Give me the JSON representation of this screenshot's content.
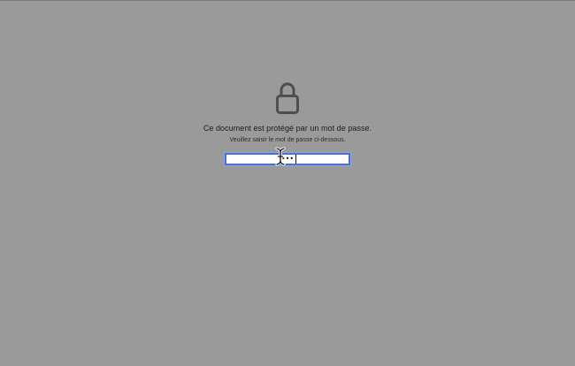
{
  "lock": {
    "icon": "lock-icon"
  },
  "prompt": {
    "title": "Ce document est protégé par un mot de passe.",
    "subtitle": "Veuillez saisir le mot de passe ci-dessous."
  },
  "password": {
    "value": "•••"
  },
  "cursor": {
    "icon": "ibeam-cursor-icon"
  },
  "colors": {
    "background": "#9a9a9a",
    "focus_ring": "#4a6fd6",
    "lock_stroke": "#4e4e4e"
  }
}
